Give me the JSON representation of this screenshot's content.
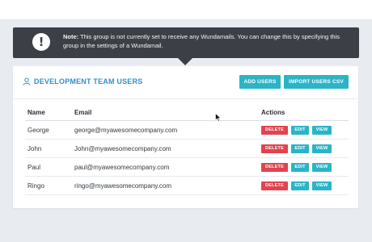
{
  "notice": {
    "icon": "exclamation-icon",
    "label": "Note:",
    "text": " This group is not currently set to receive any Wundamails. You can change this by specifying this group in the settings of a Wundamail."
  },
  "card": {
    "title_icon": "user-icon",
    "title": "DEVELOPMENT TEAM USERS",
    "add_users_label": "ADD USERS",
    "import_label": "IMPORT USERS CSV"
  },
  "table": {
    "headers": {
      "name": "Name",
      "email": "Email",
      "actions": "Actions"
    },
    "rows": [
      {
        "name": "George",
        "email": "george@myawesomecompany.com"
      },
      {
        "name": "John",
        "email": "John@myawesomecompany.com"
      },
      {
        "name": "Paul",
        "email": "paul@myawesomecompany.com"
      },
      {
        "name": "Ringo",
        "email": "ringo@myawesomecompany.com"
      }
    ],
    "actions": {
      "delete": "DELETE",
      "edit": "EDIT",
      "view": "VIEW"
    }
  },
  "colors": {
    "accent": "#2bb4c7",
    "title": "#2f8fd0",
    "danger": "#e0444f",
    "notice_bg": "#3c4046"
  }
}
